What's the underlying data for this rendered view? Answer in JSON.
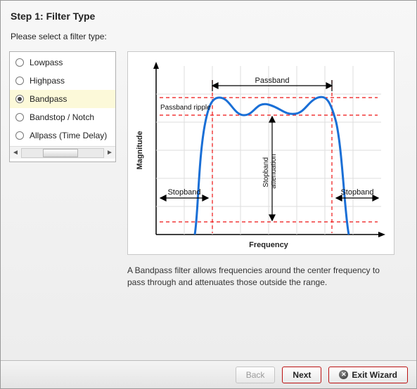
{
  "step_title": "Step 1: Filter Type",
  "prompt": "Please select a filter type:",
  "filters": {
    "items": [
      {
        "label": "Lowpass",
        "selected": false
      },
      {
        "label": "Highpass",
        "selected": false
      },
      {
        "label": "Bandpass",
        "selected": true
      },
      {
        "label": "Bandstop / Notch",
        "selected": false
      },
      {
        "label": "Allpass (Time Delay)",
        "selected": false
      }
    ]
  },
  "chart": {
    "xlabel": "Frequency",
    "ylabel": "Magnitude",
    "annotations": {
      "passband": "Passband",
      "passband_ripple": "Passband ripple",
      "stopband_left": "Stopband",
      "stopband_right": "Stopband",
      "stopband_attenuation": "Stopband\nattenuation"
    }
  },
  "description": "A Bandpass filter allows frequencies around the center frequency to pass through and attenuates those outside the range.",
  "buttons": {
    "back": "Back",
    "next": "Next",
    "exit": "Exit Wizard"
  }
}
